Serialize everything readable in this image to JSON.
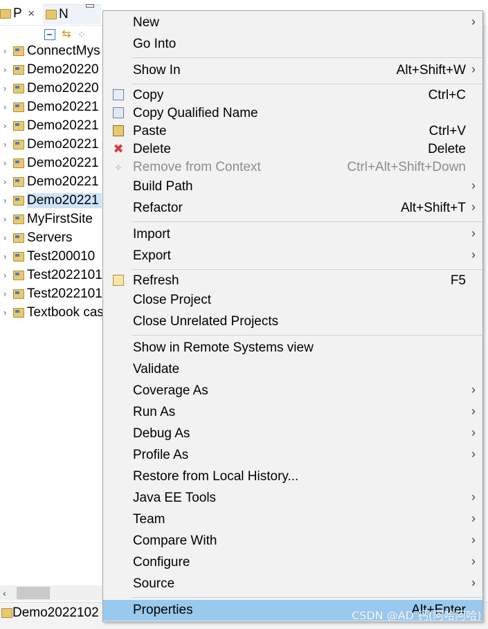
{
  "tabs": [
    {
      "label": "P",
      "active": true
    },
    {
      "label": "N",
      "active": false
    }
  ],
  "tree": {
    "items": [
      {
        "label": "ConnectMys",
        "selected": false
      },
      {
        "label": "Demo20220",
        "selected": false
      },
      {
        "label": "Demo20220",
        "selected": false
      },
      {
        "label": "Demo20221",
        "selected": false
      },
      {
        "label": "Demo20221",
        "selected": false
      },
      {
        "label": "Demo20221",
        "selected": false
      },
      {
        "label": "Demo20221",
        "selected": false
      },
      {
        "label": "Demo20221",
        "selected": false
      },
      {
        "label": "Demo20221",
        "selected": true
      },
      {
        "label": "MyFirstSite",
        "selected": false
      },
      {
        "label": "Servers",
        "selected": false
      },
      {
        "label": "Test200010",
        "selected": false
      },
      {
        "label": "Test2022101",
        "selected": false
      },
      {
        "label": "Test2022101",
        "selected": false
      },
      {
        "label": "Textbook cas",
        "selected": false
      }
    ]
  },
  "status": {
    "text": "Demo2022102"
  },
  "menu": {
    "items": [
      {
        "label": "New",
        "shortcut": "",
        "submenu": true
      },
      {
        "label": "Go Into",
        "shortcut": "",
        "submenu": false
      },
      {
        "label": "Show In",
        "shortcut": "Alt+Shift+W",
        "submenu": true
      },
      {
        "label": "Copy",
        "shortcut": "Ctrl+C",
        "submenu": false,
        "icon": "copy-icon"
      },
      {
        "label": "Copy Qualified Name",
        "shortcut": "",
        "submenu": false,
        "icon": "copy-qualified-name-icon"
      },
      {
        "label": "Paste",
        "shortcut": "Ctrl+V",
        "submenu": false,
        "icon": "paste-icon"
      },
      {
        "label": "Delete",
        "shortcut": "Delete",
        "submenu": false,
        "icon": "delete-icon"
      },
      {
        "label": "Remove from Context",
        "shortcut": "Ctrl+Alt+Shift+Down",
        "submenu": false,
        "icon": "remove-context-icon",
        "disabled": true
      },
      {
        "label": "Build Path",
        "shortcut": "",
        "submenu": true
      },
      {
        "label": "Refactor",
        "shortcut": "Alt+Shift+T",
        "submenu": true
      },
      {
        "label": "Import",
        "shortcut": "",
        "submenu": true
      },
      {
        "label": "Export",
        "shortcut": "",
        "submenu": true
      },
      {
        "label": "Refresh",
        "shortcut": "F5",
        "submenu": false,
        "icon": "refresh-icon"
      },
      {
        "label": "Close Project",
        "shortcut": "",
        "submenu": false
      },
      {
        "label": "Close Unrelated Projects",
        "shortcut": "",
        "submenu": false
      },
      {
        "label": "Show in Remote Systems view",
        "shortcut": "",
        "submenu": false
      },
      {
        "label": "Validate",
        "shortcut": "",
        "submenu": false
      },
      {
        "label": "Coverage As",
        "shortcut": "",
        "submenu": true
      },
      {
        "label": "Run As",
        "shortcut": "",
        "submenu": true
      },
      {
        "label": "Debug As",
        "shortcut": "",
        "submenu": true
      },
      {
        "label": "Profile As",
        "shortcut": "",
        "submenu": true
      },
      {
        "label": "Restore from Local History...",
        "shortcut": "",
        "submenu": false
      },
      {
        "label": "Java EE Tools",
        "shortcut": "",
        "submenu": true
      },
      {
        "label": "Team",
        "shortcut": "",
        "submenu": true
      },
      {
        "label": "Compare With",
        "shortcut": "",
        "submenu": true
      },
      {
        "label": "Configure",
        "shortcut": "",
        "submenu": true
      },
      {
        "label": "Source",
        "shortcut": "",
        "submenu": true
      },
      {
        "label": "Properties",
        "shortcut": "Alt+Enter",
        "submenu": false,
        "highlighted": true
      }
    ],
    "submenu_arrow": "›"
  },
  "watermark": "CSDN @AD 钙(阿哈阿哈)"
}
